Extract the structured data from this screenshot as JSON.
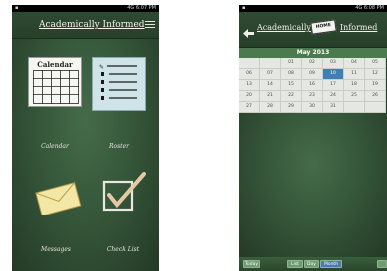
{
  "left": {
    "status": {
      "signal": "4G",
      "time": "6:07 PM"
    },
    "app_title": "Academically Informed",
    "tiles": [
      {
        "icon": "calendar-icon",
        "icon_text": "Calendar",
        "label": "Calendar"
      },
      {
        "icon": "roster-icon",
        "label": "Roster"
      },
      {
        "icon": "messages-icon",
        "label": "Messages"
      },
      {
        "icon": "checklist-icon",
        "label": "Check List"
      }
    ]
  },
  "right": {
    "status": {
      "signal": "4G",
      "time": "6:08 PM"
    },
    "app_title_left": "Academically",
    "home_badge": "HOME",
    "app_title_right": "Informed",
    "month": "May 2013",
    "weeks": [
      [
        "",
        "",
        "01",
        "02",
        "03",
        "04",
        "05"
      ],
      [
        "06",
        "07",
        "08",
        "09",
        "10",
        "11",
        "12"
      ],
      [
        "13",
        "14",
        "15",
        "16",
        "17",
        "18",
        "19"
      ],
      [
        "20",
        "21",
        "22",
        "23",
        "24",
        "25",
        "26"
      ],
      [
        "27",
        "28",
        "29",
        "30",
        "31",
        "",
        ""
      ]
    ],
    "selected_day": "10",
    "buttons": {
      "today": "Today",
      "list": "List",
      "day": "Day",
      "month": "Month"
    }
  },
  "colors": {
    "chalkboard": "#36573a",
    "selected": "#3f7fb5"
  }
}
